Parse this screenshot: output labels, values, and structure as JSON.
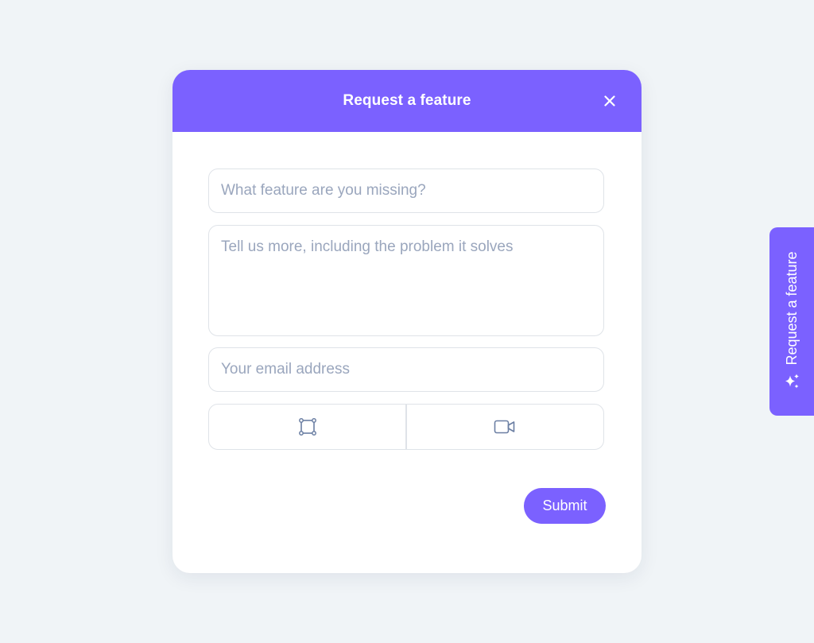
{
  "modal": {
    "title": "Request a feature",
    "feature_placeholder": "What feature are you missing?",
    "details_placeholder": "Tell us more, including the problem it solves",
    "email_placeholder": "Your email address",
    "submit_label": "Submit",
    "attachments": [
      {
        "icon": "screenshot-icon"
      },
      {
        "icon": "video-camera-icon"
      }
    ]
  },
  "side_tab": {
    "label": "Request a feature",
    "icon": "sparkle-icon"
  },
  "colors": {
    "accent": "#7b61ff",
    "background": "#f0f4f7",
    "placeholder": "#9aa6bd",
    "border": "#dfe3e8",
    "icon": "#6b7fa3"
  }
}
